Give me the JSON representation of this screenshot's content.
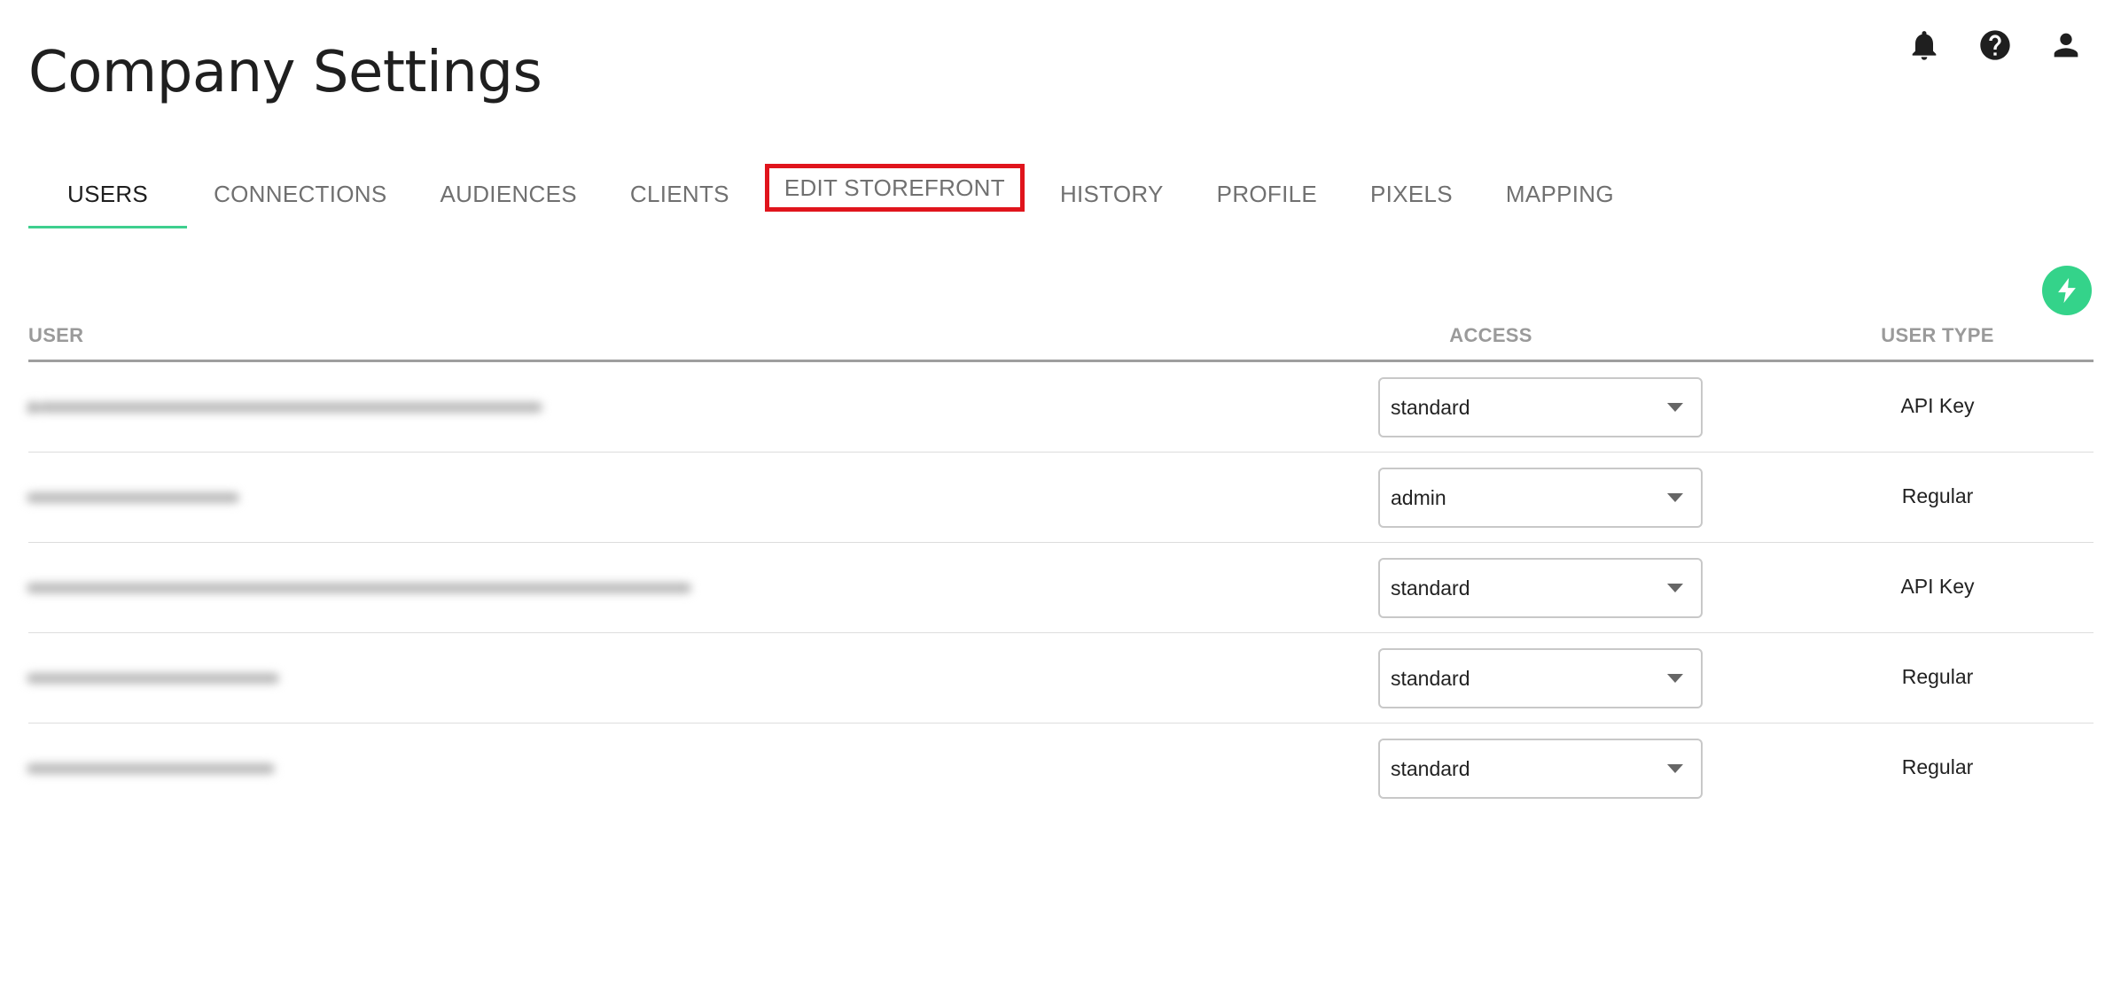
{
  "header": {
    "title": "Company Settings",
    "icons": [
      "bell-icon",
      "help-icon",
      "account-icon"
    ]
  },
  "tabs": [
    {
      "label": "USERS",
      "active": true
    },
    {
      "label": "CONNECTIONS"
    },
    {
      "label": "AUDIENCES"
    },
    {
      "label": "CLIENTS"
    },
    {
      "label": "EDIT STOREFRONT",
      "highlighted": true
    },
    {
      "label": "HISTORY"
    },
    {
      "label": "PROFILE"
    },
    {
      "label": "PIXELS"
    },
    {
      "label": "MAPPING"
    }
  ],
  "colors": {
    "accent": "#3ecf8e",
    "fab": "#34d38a",
    "highlight_box": "#e0141c"
  },
  "table": {
    "columns": {
      "user": "USER",
      "access": "ACCESS",
      "user_type": "USER TYPE"
    },
    "rows": [
      {
        "user": "a",
        "access": "standard",
        "user_type": "API Key"
      },
      {
        "user": "",
        "access": "admin",
        "user_type": "Regular"
      },
      {
        "user": "",
        "access": "standard",
        "user_type": "API Key"
      },
      {
        "user": "",
        "access": "standard",
        "user_type": "Regular"
      },
      {
        "user": "",
        "access": "standard",
        "user_type": "Regular"
      }
    ]
  }
}
